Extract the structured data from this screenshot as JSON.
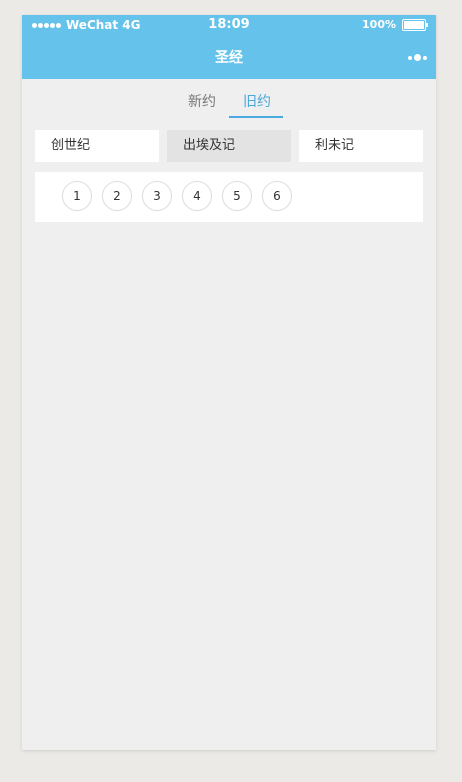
{
  "status_bar": {
    "carrier": "WeChat 4G",
    "time": "18:09",
    "battery": "100%"
  },
  "nav": {
    "title": "圣经"
  },
  "tabs": [
    {
      "label": "新约",
      "active": false
    },
    {
      "label": "旧约",
      "active": true
    }
  ],
  "books": [
    {
      "label": "创世纪",
      "selected": false
    },
    {
      "label": "出埃及记",
      "selected": true
    },
    {
      "label": "利未记",
      "selected": false
    }
  ],
  "chapters": [
    "1",
    "2",
    "3",
    "4",
    "5",
    "6"
  ],
  "colors": {
    "accent": "#65c3eb",
    "tab_active": "#4aa9de",
    "background": "#efefef"
  }
}
